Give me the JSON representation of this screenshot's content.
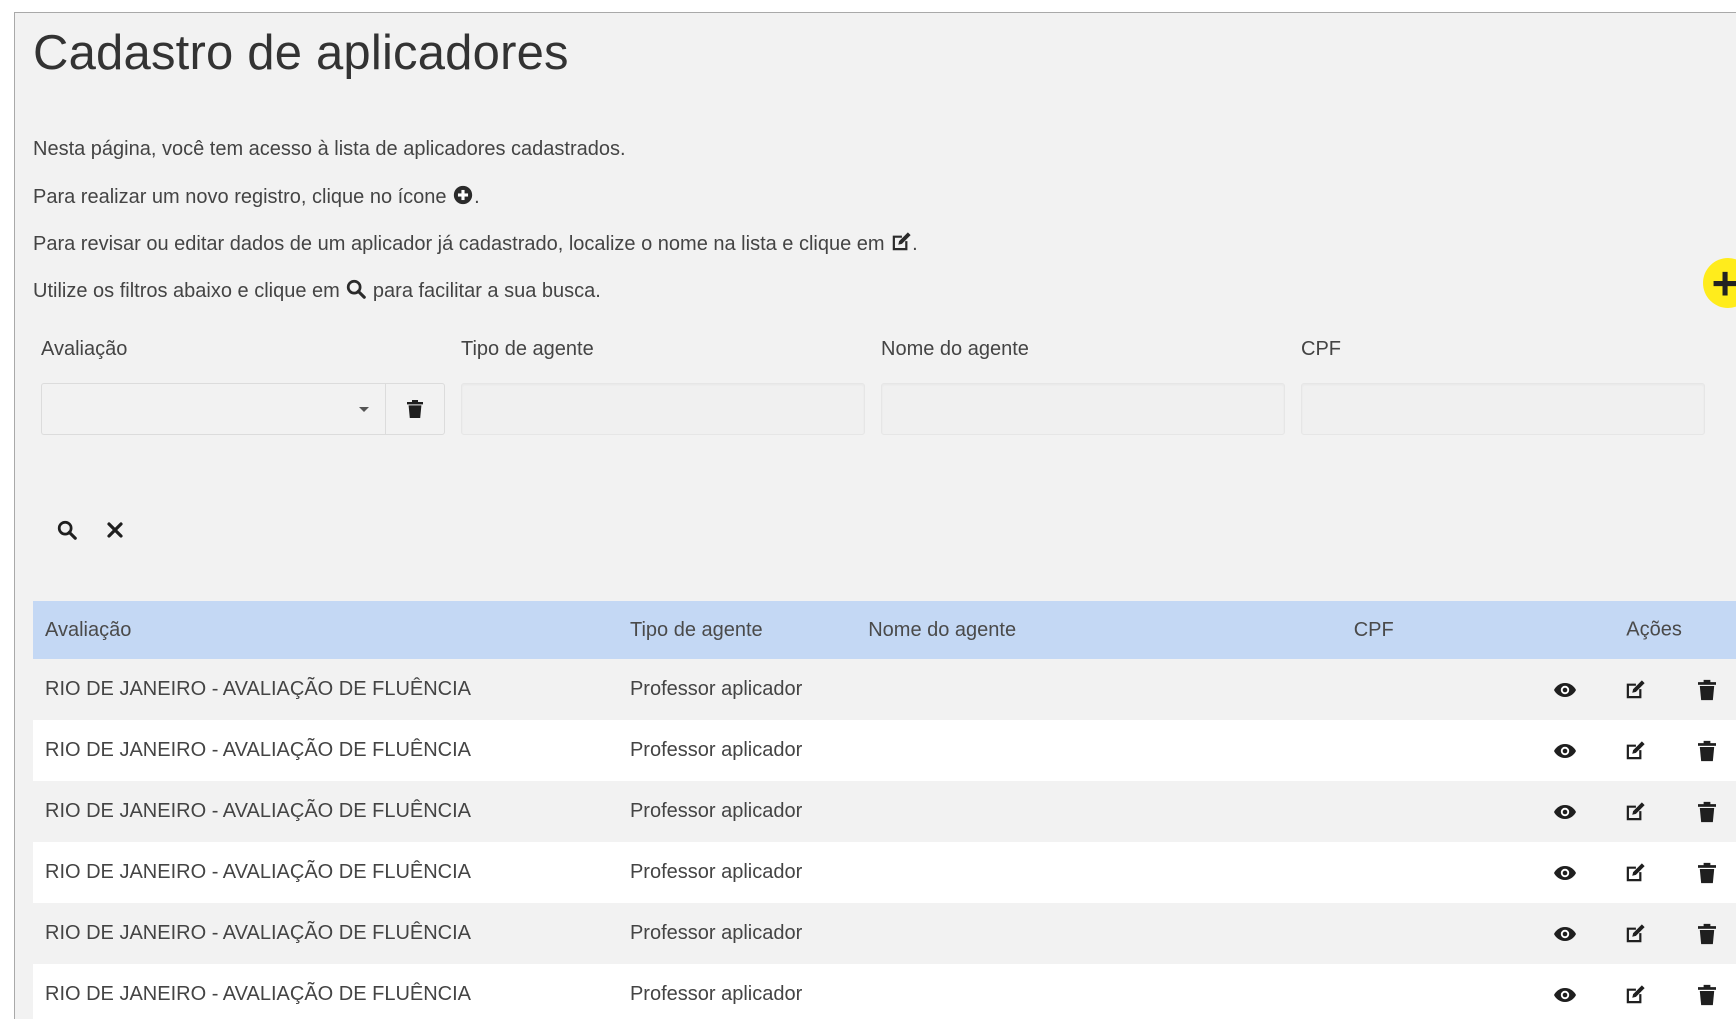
{
  "page": {
    "title": "Cadastro de aplicadores"
  },
  "intro": {
    "line1": "Nesta página, você tem acesso à lista de aplicadores cadastrados.",
    "line2_before": "Para realizar um novo registro, clique no ícone ",
    "line2_after": ".",
    "line3_before": "Para revisar ou editar dados de um aplicador já cadastrado, localize o nome na lista e clique em ",
    "line3_after": ".",
    "line4_before": "Utilize os filtros abaixo e clique em ",
    "line4_after": " para facilitar a sua busca."
  },
  "filters": {
    "avaliacao_label": "Avaliação",
    "avaliacao_value": "",
    "tipo_label": "Tipo de agente",
    "tipo_value": "",
    "nome_label": "Nome do agente",
    "nome_value": "",
    "cpf_label": "CPF",
    "cpf_value": ""
  },
  "table": {
    "headers": {
      "avaliacao": "Avaliação",
      "tipo": "Tipo de agente",
      "nome": "Nome do agente",
      "cpf": "CPF",
      "acoes": "Ações"
    },
    "rows": [
      {
        "avaliacao": "RIO DE JANEIRO - AVALIAÇÃO DE FLUÊNCIA",
        "tipo": "Professor aplicador",
        "nome": "",
        "cpf": ""
      },
      {
        "avaliacao": "RIO DE JANEIRO - AVALIAÇÃO DE FLUÊNCIA",
        "tipo": "Professor aplicador",
        "nome": "",
        "cpf": ""
      },
      {
        "avaliacao": "RIO DE JANEIRO - AVALIAÇÃO DE FLUÊNCIA",
        "tipo": "Professor aplicador",
        "nome": "",
        "cpf": ""
      },
      {
        "avaliacao": "RIO DE JANEIRO - AVALIAÇÃO DE FLUÊNCIA",
        "tipo": "Professor aplicador",
        "nome": "",
        "cpf": ""
      },
      {
        "avaliacao": "RIO DE JANEIRO - AVALIAÇÃO DE FLUÊNCIA",
        "tipo": "Professor aplicador",
        "nome": "",
        "cpf": ""
      },
      {
        "avaliacao": "RIO DE JANEIRO - AVALIAÇÃO DE FLUÊNCIA",
        "tipo": "Professor aplicador",
        "nome": "",
        "cpf": ""
      }
    ]
  },
  "icons": {
    "add": "plus-icon",
    "add_inline": "plus-circle-icon",
    "edit": "edit-icon",
    "search": "search-icon",
    "clear": "close-icon",
    "trash": "trash-icon",
    "view": "eye-icon"
  },
  "colors": {
    "background": "#f2f2f2",
    "table_header": "#c4d8f4",
    "add_button": "#ffec1c",
    "text": "#333333"
  }
}
